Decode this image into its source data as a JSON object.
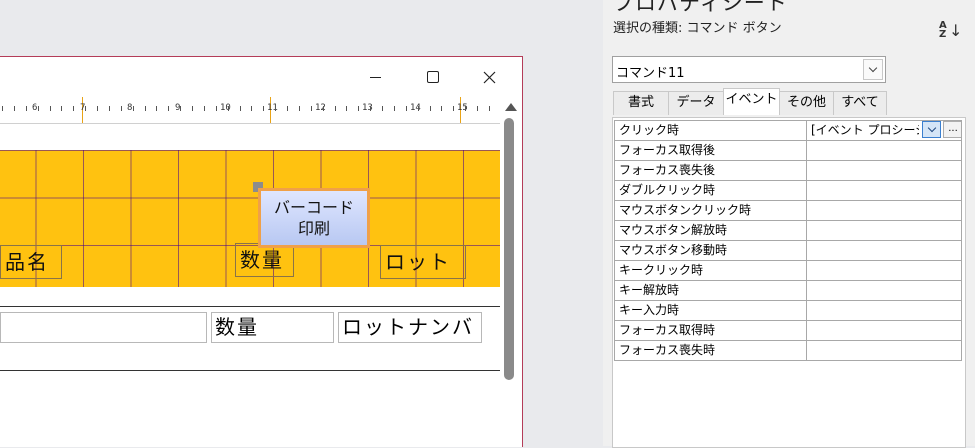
{
  "form_window": {
    "ruler_numbers": [
      "6",
      "7",
      "8",
      "9",
      "10",
      "11",
      "12",
      "13",
      "14",
      "15"
    ],
    "header_labels": {
      "hinmei": "品名",
      "suryo": "数量",
      "lot": "ロット"
    },
    "barcode_button": {
      "line1": "バーコード",
      "line2": "印刷"
    },
    "detail_fields": {
      "hinmei": "",
      "suryo": "数量",
      "lot": "ロットナンバ"
    }
  },
  "property_sheet": {
    "title": "プロパティシート",
    "selection_type": "選択の種類:  コマンド ボタン",
    "object_select": "コマンド11",
    "tabs": [
      "書式",
      "データ",
      "イベント",
      "その他",
      "すべて"
    ],
    "active_tab": "イベント",
    "rows": [
      {
        "name": "クリック時",
        "value": "[イベント プロシージャ]"
      },
      {
        "name": "フォーカス取得後",
        "value": ""
      },
      {
        "name": "フォーカス喪失後",
        "value": ""
      },
      {
        "name": "ダブルクリック時",
        "value": ""
      },
      {
        "name": "マウスボタンクリック時",
        "value": ""
      },
      {
        "name": "マウスボタン解放時",
        "value": ""
      },
      {
        "name": "マウスボタン移動時",
        "value": ""
      },
      {
        "name": "キークリック時",
        "value": ""
      },
      {
        "name": "キー解放時",
        "value": ""
      },
      {
        "name": "キー入力時",
        "value": ""
      },
      {
        "name": "フォーカス取得時",
        "value": ""
      },
      {
        "name": "フォーカス喪失時",
        "value": ""
      }
    ],
    "builder_label": "..."
  },
  "icons": {
    "minimize": "minimize-icon",
    "maximize": "maximize-icon",
    "close": "close-icon",
    "sort": "sort-az-icon",
    "dropdown": "chevron-down-icon"
  }
}
